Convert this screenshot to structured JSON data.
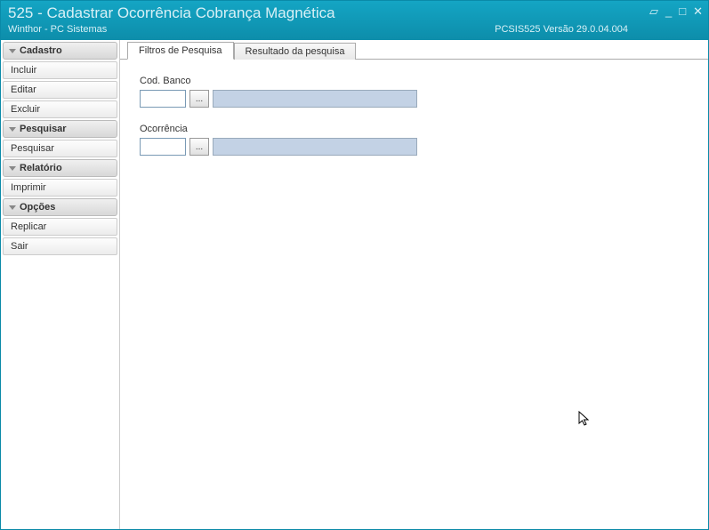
{
  "titlebar": {
    "title": "525 - Cadastrar Ocorrência Cobrança Magnética",
    "subtitle": "Winthor - PC Sistemas",
    "version": "PCSIS525  Versão  29.0.04.004"
  },
  "sidebar": {
    "sections": [
      {
        "header": "Cadastro",
        "items": [
          "Incluir",
          "Editar",
          "Excluir"
        ]
      },
      {
        "header": "Pesquisar",
        "items": [
          "Pesquisar"
        ]
      },
      {
        "header": "Relatório",
        "items": [
          "Imprimir"
        ]
      },
      {
        "header": "Opções",
        "items": [
          "Replicar",
          "Sair"
        ]
      }
    ]
  },
  "tabs": {
    "filtros": "Filtros de Pesquisa",
    "resultado": "Resultado da pesquisa"
  },
  "fields": {
    "codbanco": {
      "label": "Cod. Banco",
      "value": "",
      "lookup": "..."
    },
    "ocorrencia": {
      "label": "Ocorrência",
      "value": "",
      "lookup": "..."
    }
  }
}
